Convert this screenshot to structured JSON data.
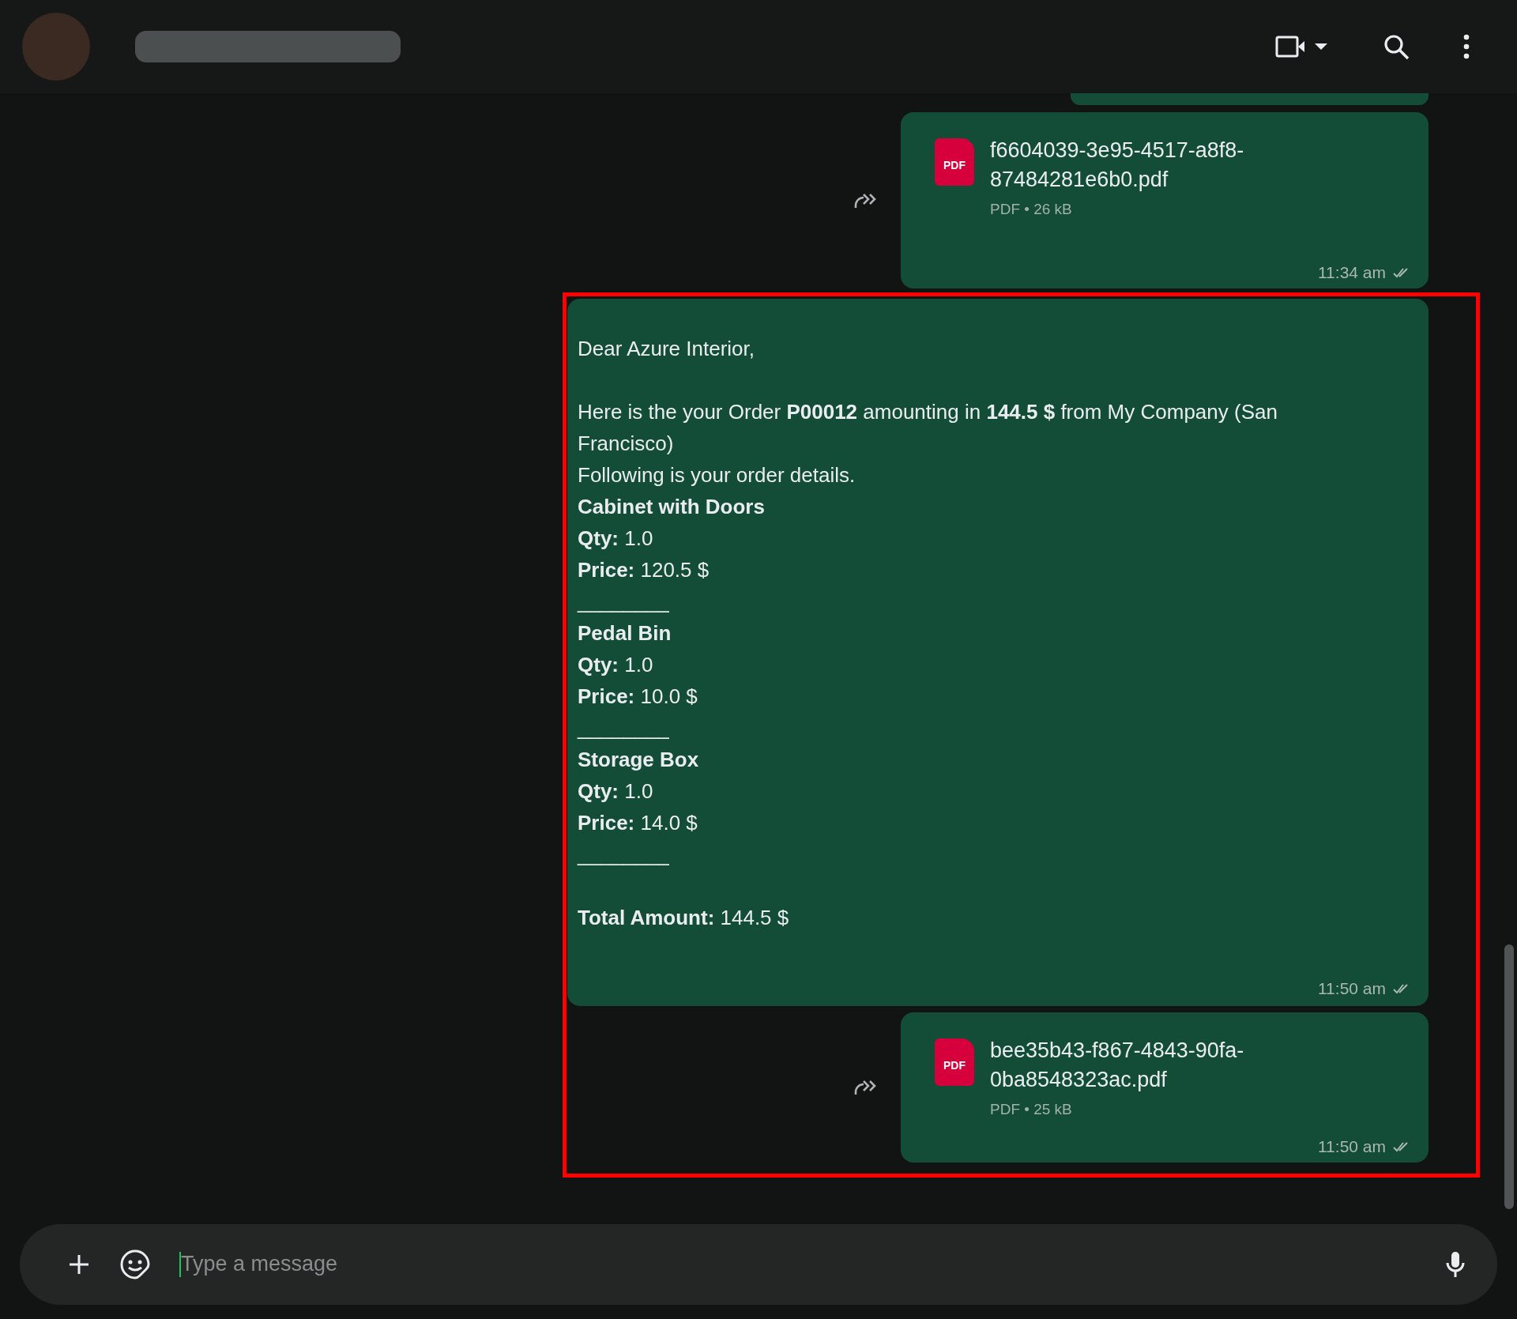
{
  "messages": [
    {
      "kind": "fragment"
    },
    {
      "kind": "file",
      "badge": "PDF",
      "filename": "f6604039-3e95-4517-a8f8-87484281e6b0.pdf",
      "meta": "PDF • 26 kB",
      "time": "11:34 am"
    },
    {
      "kind": "text",
      "time": "11:50 am",
      "lines": [
        {
          "kind": "text",
          "text": "Dear Azure Interior,",
          "gap_before": false
        },
        {
          "kind": "text",
          "text": "Here is the your Order **P00012** amounting in **144.5 $** from My Company (San Francisco)",
          "gap_before": true
        },
        {
          "kind": "text",
          "text": "Following is your order details.",
          "gap_before": false
        },
        {
          "kind": "item",
          "text": "Cabinet with Doors",
          "gap_before": false
        },
        {
          "kind": "text",
          "text": "**Qty:** 1.0",
          "gap_before": false
        },
        {
          "kind": "text",
          "text": "**Price:** 120.5 $",
          "gap_before": false
        },
        {
          "kind": "rule",
          "text": "________",
          "gap_before": false
        },
        {
          "kind": "item",
          "text": "Pedal Bin",
          "gap_before": false
        },
        {
          "kind": "text",
          "text": "**Qty:** 1.0",
          "gap_before": false
        },
        {
          "kind": "text",
          "text": "**Price:** 10.0 $",
          "gap_before": false
        },
        {
          "kind": "rule",
          "text": "________",
          "gap_before": false
        },
        {
          "kind": "item",
          "text": "Storage Box",
          "gap_before": false
        },
        {
          "kind": "text",
          "text": "**Qty:** 1.0",
          "gap_before": false
        },
        {
          "kind": "text",
          "text": "**Price:** 14.0 $",
          "gap_before": false
        },
        {
          "kind": "rule",
          "text": "________",
          "gap_before": false
        },
        {
          "kind": "text",
          "text": "**Total Amount:** 144.5 $",
          "gap_before": true
        }
      ]
    },
    {
      "kind": "file",
      "badge": "PDF",
      "filename": "bee35b43-f867-4843-90fa-0ba8548323ac.pdf",
      "meta": "PDF • 25 kB",
      "time": "11:50 am"
    }
  ],
  "composer": {
    "placeholder": "Type a message"
  }
}
